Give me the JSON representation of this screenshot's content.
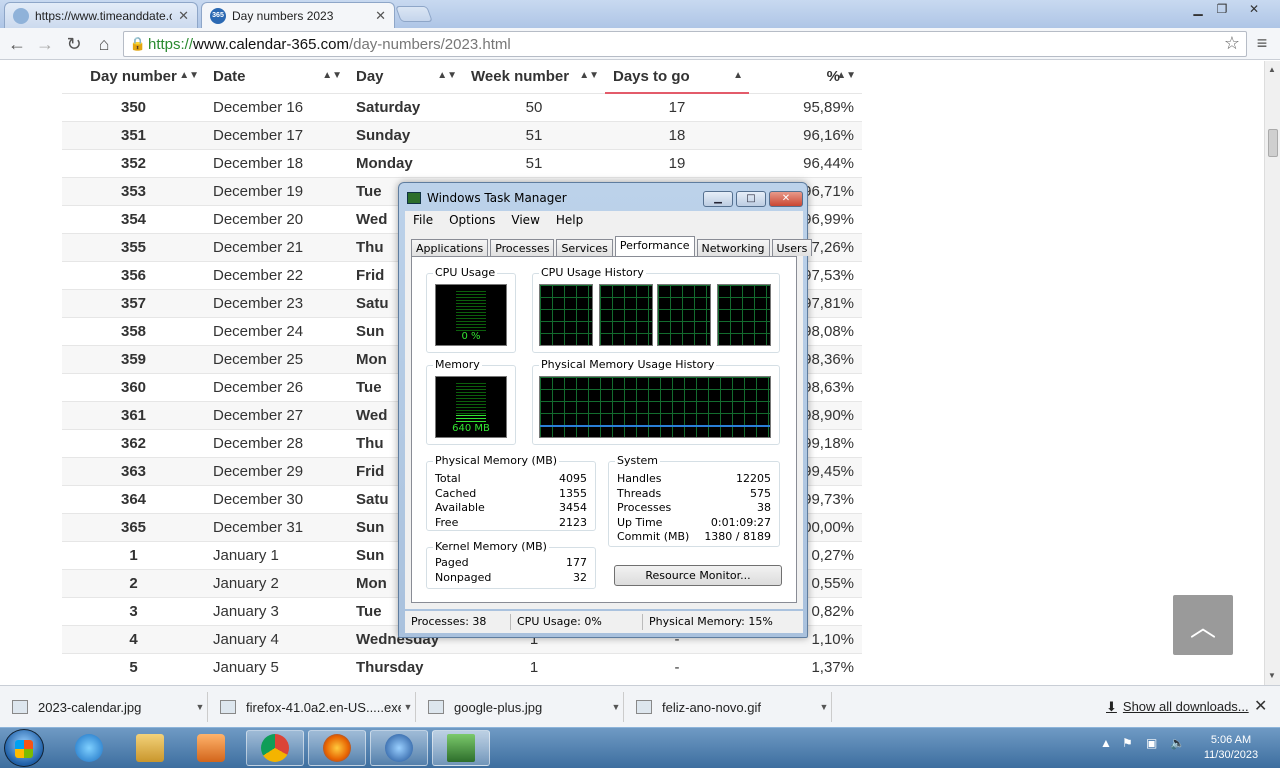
{
  "browser": {
    "tabs": [
      {
        "title": "https://www.timeanddate.com",
        "active": false
      },
      {
        "title": "Day numbers 2023",
        "active": true
      }
    ],
    "url_scheme": "https://",
    "url_host": "www.calendar-365.com",
    "url_path": "/day-numbers/2023.html"
  },
  "table": {
    "headers": [
      "Day number",
      "Date",
      "Day",
      "Week number",
      "Days to go",
      "%"
    ],
    "rows": [
      {
        "num": "350",
        "date": "December 16",
        "day": "Saturday",
        "week": "50",
        "togo": "17",
        "pct": "95,89%"
      },
      {
        "num": "351",
        "date": "December 17",
        "day": "Sunday",
        "week": "51",
        "togo": "18",
        "pct": "96,16%"
      },
      {
        "num": "352",
        "date": "December 18",
        "day": "Monday",
        "week": "51",
        "togo": "19",
        "pct": "96,44%"
      },
      {
        "num": "353",
        "date": "December 19",
        "day": "Tue",
        "week": "",
        "togo": "",
        "pct": "96,71%"
      },
      {
        "num": "354",
        "date": "December 20",
        "day": "Wed",
        "week": "",
        "togo": "",
        "pct": "96,99%"
      },
      {
        "num": "355",
        "date": "December 21",
        "day": "Thu",
        "week": "",
        "togo": "",
        "pct": "97,26%"
      },
      {
        "num": "356",
        "date": "December 22",
        "day": "Frid",
        "week": "",
        "togo": "",
        "pct": "97,53%"
      },
      {
        "num": "357",
        "date": "December 23",
        "day": "Satu",
        "week": "",
        "togo": "",
        "pct": "97,81%"
      },
      {
        "num": "358",
        "date": "December 24",
        "day": "Sun",
        "week": "",
        "togo": "",
        "pct": "98,08%"
      },
      {
        "num": "359",
        "date": "December 25",
        "day": "Mon",
        "week": "",
        "togo": "",
        "pct": "98,36%"
      },
      {
        "num": "360",
        "date": "December 26",
        "day": "Tue",
        "week": "",
        "togo": "",
        "pct": "98,63%"
      },
      {
        "num": "361",
        "date": "December 27",
        "day": "Wed",
        "week": "",
        "togo": "",
        "pct": "98,90%"
      },
      {
        "num": "362",
        "date": "December 28",
        "day": "Thu",
        "week": "",
        "togo": "",
        "pct": "99,18%"
      },
      {
        "num": "363",
        "date": "December 29",
        "day": "Frid",
        "week": "",
        "togo": "",
        "pct": "99,45%"
      },
      {
        "num": "364",
        "date": "December 30",
        "day": "Satu",
        "week": "",
        "togo": "",
        "pct": "99,73%"
      },
      {
        "num": "365",
        "date": "December 31",
        "day": "Sun",
        "week": "",
        "togo": "",
        "pct": "00,00%"
      },
      {
        "num": "1",
        "date": "January 1",
        "day": "Sun",
        "week": "",
        "togo": "",
        "pct": "0,27%"
      },
      {
        "num": "2",
        "date": "January 2",
        "day": "Mon",
        "week": "",
        "togo": "",
        "pct": "0,55%"
      },
      {
        "num": "3",
        "date": "January 3",
        "day": "Tue",
        "week": "",
        "togo": "",
        "pct": "0,82%"
      },
      {
        "num": "4",
        "date": "January 4",
        "day": "Wednesday",
        "week": "1",
        "togo": "-",
        "pct": "1,10%"
      },
      {
        "num": "5",
        "date": "January 5",
        "day": "Thursday",
        "week": "1",
        "togo": "-",
        "pct": "1,37%"
      }
    ]
  },
  "taskmanager": {
    "title": "Windows Task Manager",
    "menu": [
      "File",
      "Options",
      "View",
      "Help"
    ],
    "tabs": [
      "Applications",
      "Processes",
      "Services",
      "Performance",
      "Networking",
      "Users"
    ],
    "active_tab": "Performance",
    "cpu_label": "CPU Usage",
    "cpu_value": "0 %",
    "cpu_history_label": "CPU Usage History",
    "mem_label": "Memory",
    "mem_value": "640 MB",
    "mem_history_label": "Physical Memory Usage History",
    "physical": {
      "label": "Physical Memory (MB)",
      "rows": [
        [
          "Total",
          "4095"
        ],
        [
          "Cached",
          "1355"
        ],
        [
          "Available",
          "3454"
        ],
        [
          "Free",
          "2123"
        ]
      ]
    },
    "kernel": {
      "label": "Kernel Memory (MB)",
      "rows": [
        [
          "Paged",
          "177"
        ],
        [
          "Nonpaged",
          "32"
        ]
      ]
    },
    "system": {
      "label": "System",
      "rows": [
        [
          "Handles",
          "12205"
        ],
        [
          "Threads",
          "575"
        ],
        [
          "Processes",
          "38"
        ],
        [
          "Up Time",
          "0:01:09:27"
        ],
        [
          "Commit (MB)",
          "1380 / 8189"
        ]
      ]
    },
    "resource_button": "Resource Monitor...",
    "status": [
      "Processes: 38",
      "CPU Usage: 0%",
      "Physical Memory: 15%"
    ]
  },
  "downloads": {
    "items": [
      "2023-calendar.jpg",
      "firefox-41.0a2.en-US.....exe",
      "google-plus.jpg",
      "feliz-ano-novo.gif"
    ],
    "show_all": "Show all downloads..."
  },
  "clock": {
    "time": "5:06 AM",
    "date": "11/30/2023"
  }
}
